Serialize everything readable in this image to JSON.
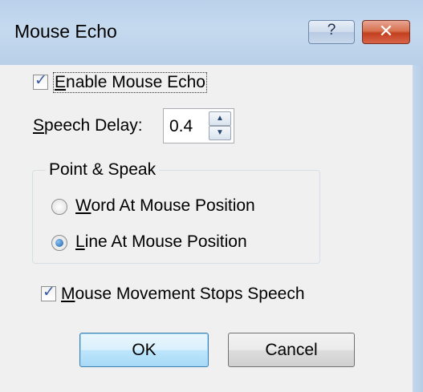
{
  "window": {
    "title": "Mouse Echo",
    "help_glyph": "?",
    "close_glyph": "✕"
  },
  "enable_mouse_echo": {
    "checked": true,
    "label_hotkey": "E",
    "label_rest": "nable Mouse Echo"
  },
  "speech_delay": {
    "label_hotkey": "S",
    "label_rest": "peech Delay:",
    "value": "0.4",
    "up_glyph": "▲",
    "down_glyph": "▼"
  },
  "point_and_speak": {
    "title": "Point & Speak",
    "options": [
      {
        "hotkey": "W",
        "rest": "ord At Mouse Position",
        "selected": false
      },
      {
        "hotkey": "L",
        "rest": "ine At Mouse Position",
        "selected": true
      }
    ]
  },
  "mouse_movement_stops_speech": {
    "checked": true,
    "label_hotkey": "M",
    "label_rest": "ouse Movement Stops Speech"
  },
  "buttons": {
    "ok": "OK",
    "cancel": "Cancel"
  },
  "colors": {
    "title_bar": "#b9d1ea",
    "close_button": "#c2401e",
    "default_button_border": "#3c7fb1"
  }
}
